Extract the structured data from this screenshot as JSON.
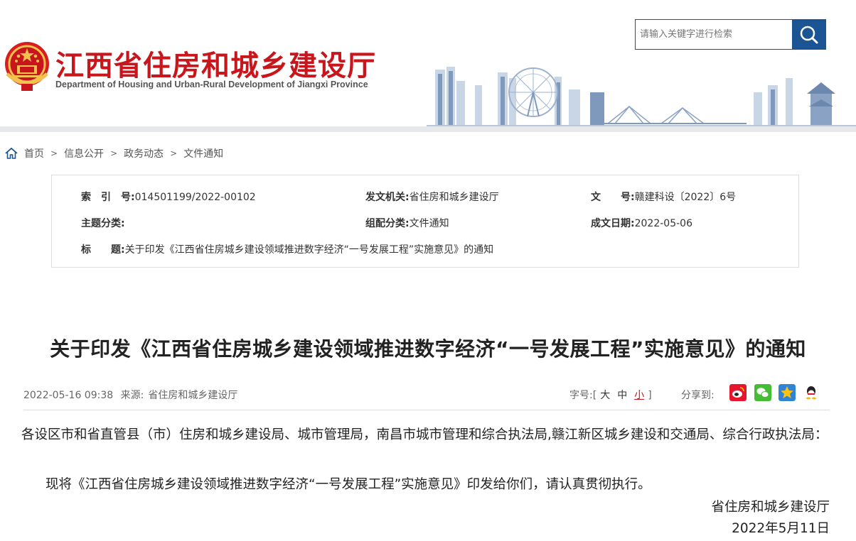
{
  "header": {
    "title": "江西省住房和城乡建设厅",
    "subtitle": "Department of Housing and Urban-Rural Development of Jiangxi Province",
    "search_placeholder": "请输入关键字进行检索",
    "colors": {
      "brand_red": "#c8161d",
      "brand_blue": "#1c5594"
    }
  },
  "breadcrumb": {
    "home_icon": "home-icon",
    "items": [
      "首页",
      "信息公开",
      "政务动态",
      "文件通知"
    ],
    "separator": ">"
  },
  "meta": {
    "index_label": "索　引　号:",
    "index_value": "014501199/2022-00102",
    "issuer_label": "发文机关:",
    "issuer_value": "省住房和城乡建设厅",
    "docno_label": "文　　号:",
    "docno_value": "赣建科设〔2022〕6号",
    "topic_label": "主题分类:",
    "topic_value": "",
    "category_label": "组配分类:",
    "category_value": "文件通知",
    "date_label": "成文日期:",
    "date_value": "2022-05-06",
    "title_label": "标　　题:",
    "title_value": "关于印发《江西省住房城乡建设领域推进数字经济“一号发展工程”实施意见》的通知"
  },
  "article": {
    "title": "关于印发《江西省住房城乡建设领域推进数字经济“一号发展工程”实施意见》的通知",
    "published": "2022-05-16 09:38",
    "source_label": "来源:",
    "source": "省住房和城乡建设厅",
    "fontsize_label": "字号:",
    "fontsize_open": "[",
    "fontsize_close": "]",
    "fontsize_options": [
      "大",
      "中",
      "小"
    ],
    "fontsize_selected": "小",
    "share_label": "分享到:",
    "share_icons": [
      "weibo-icon",
      "wechat-icon",
      "qzone-icon",
      "qq-icon"
    ],
    "paragraph1": "各设区市和省直管县（市）住房和城乡建设局、城市管理局，南昌市城市管理和综合执法局,赣江新区城乡建设和交通局、综合行政执法局：",
    "paragraph2": "现将《江西省住房城乡建设领域推进数字经济“一号发展工程”实施意见》印发给你们，请认真贯彻执行。",
    "signature_org": "省住房和城乡建设厅",
    "signature_date": "2022年5月11日"
  }
}
